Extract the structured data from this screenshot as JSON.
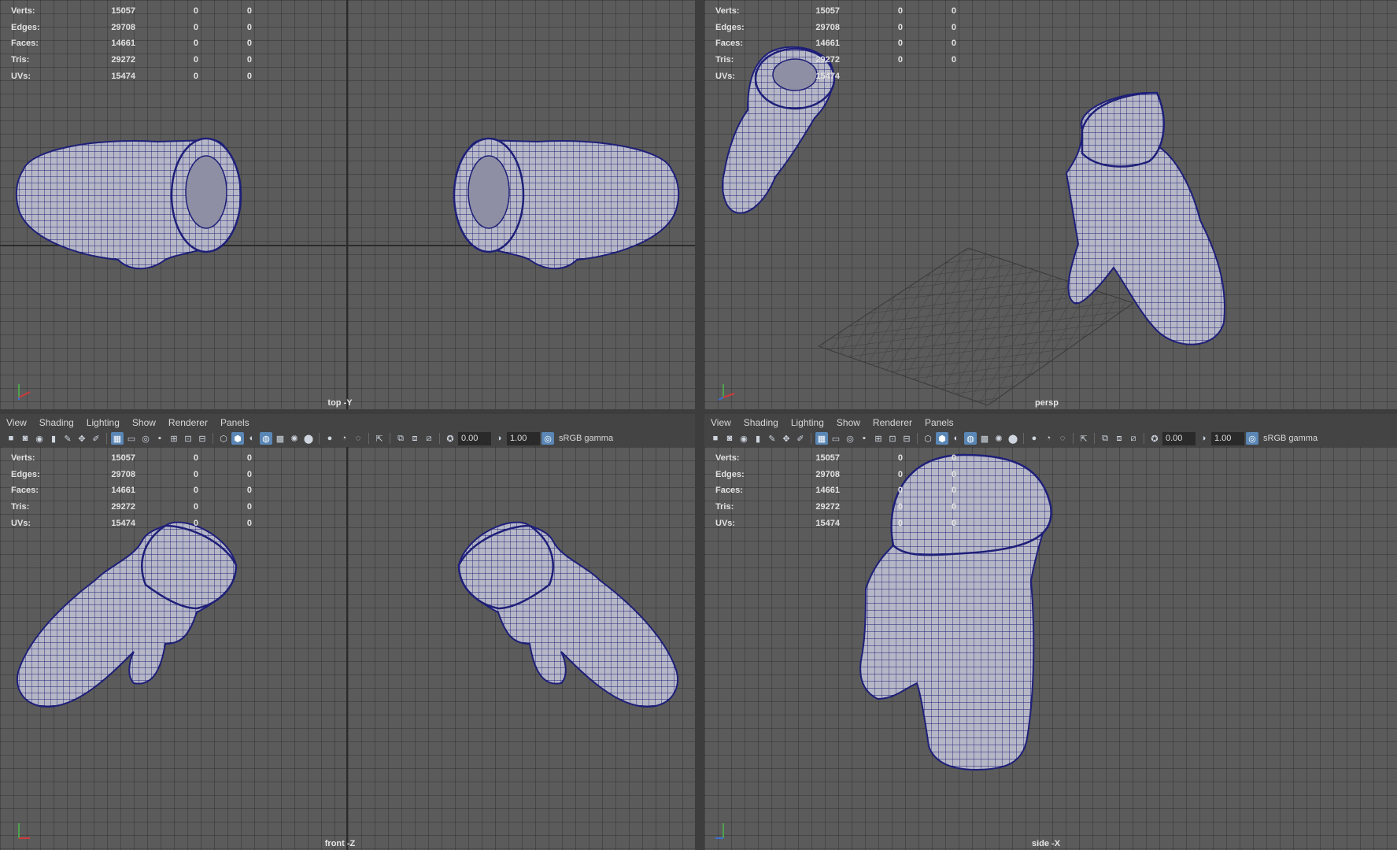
{
  "colors": {
    "viewport_bg": "#5b5b5b",
    "mesh_fill": "#b6b7c6",
    "mesh_wire": "#1e1f78",
    "ui_bar": "#444444",
    "active_icon": "#5a87b5"
  },
  "hud": {
    "labels": [
      "Verts:",
      "Edges:",
      "Faces:",
      "Tris:",
      "UVs:"
    ],
    "values": [
      "15057",
      "29708",
      "14661",
      "29272",
      "15474"
    ],
    "zero": "0"
  },
  "viewports": {
    "top_left": {
      "camera": "top -Y"
    },
    "top_right": {
      "camera": "persp"
    },
    "bottom_left": {
      "camera": "front -Z"
    },
    "bottom_right": {
      "camera": "side -X"
    }
  },
  "menu": {
    "items": [
      "View",
      "Shading",
      "Lighting",
      "Show",
      "Renderer",
      "Panels"
    ]
  },
  "toolbar": {
    "exposure": "0.00",
    "gamma": "1.00",
    "color_space": "sRGB gamma",
    "icons": [
      "camera-select-icon",
      "camera-lock-icon",
      "camera-attr-icon",
      "bookmark-icon",
      "image-plane-icon",
      "grid-icon",
      "film-gate-icon",
      "resolution-gate-icon",
      "gate-mask-icon",
      "field-chart-icon",
      "safe-action-icon",
      "safe-title-icon",
      "wireframe-icon",
      "smooth-shade-icon",
      "default-material-icon",
      "wireframe-on-shaded-icon",
      "textured-icon",
      "lights-icon",
      "shadows-icon",
      "ambient-occlusion-icon",
      "motion-blur-icon",
      "anti-aliasing-icon",
      "depth-of-field-icon",
      "isolate-select-icon",
      "xray-icon",
      "xray-joints-icon",
      "xray-components-icon",
      "exposure-icon",
      "gamma-icon",
      "color-management-icon"
    ]
  }
}
